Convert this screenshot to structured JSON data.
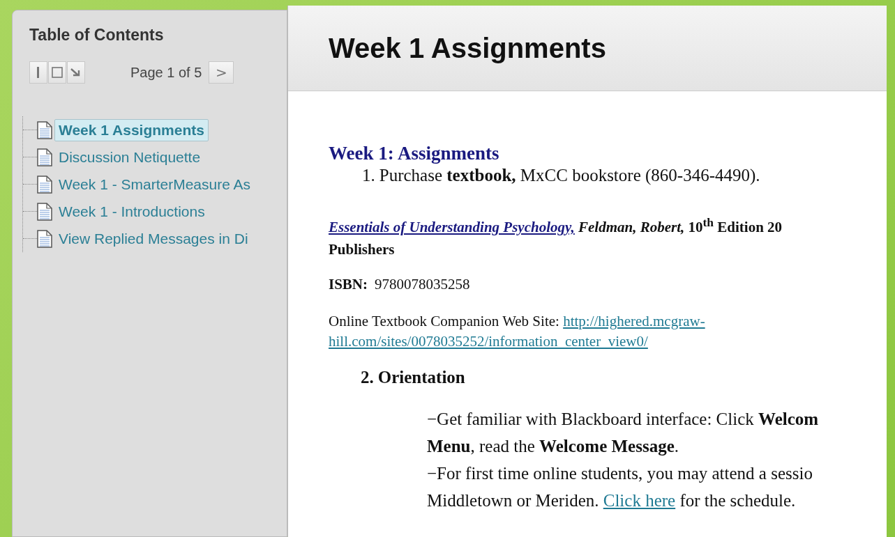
{
  "toc": {
    "title": "Table of Contents",
    "page_label": "Page 1 of 5",
    "next_button": ">",
    "items": [
      {
        "label": "Week 1 Assignments",
        "selected": true
      },
      {
        "label": "Discussion Netiquette",
        "selected": false
      },
      {
        "label": "Week 1 - SmarterMeasure As",
        "selected": false
      },
      {
        "label": "Week 1 - Introductions",
        "selected": false
      },
      {
        "label": "View Replied Messages in Di",
        "selected": false
      }
    ]
  },
  "content": {
    "title": "Week 1 Assignments",
    "blocks": [
      {
        "kind": "heading",
        "text": "Week 1: Assignments"
      },
      {
        "kind": "numbered",
        "number": "1.",
        "text": "Purchase **textbook,** MxCC bookstore (860-346-4490)."
      },
      {
        "kind": "citation",
        "link": "Essentials of Understanding Psychology,",
        "text": "*Feldman, Robert,* 10$^{th}$ Edition 20",
        "second_line": "Publishers"
      },
      {
        "kind": "isbn",
        "label": "ISBN:",
        "value": "9780078035258"
      },
      {
        "kind": "web",
        "label": "Online Textbook Companion Web Site:",
        "link_lines": [
          "http://highered.mcgraw-",
          "hill.com/sites/0078035252/information_center_view0/"
        ]
      },
      {
        "kind": "subheading",
        "number": "2.",
        "text": "Orientation"
      },
      {
        "kind": "lines",
        "lines": [
          {
            "text": "−Get familiar with Blackboard interface: Click **Welcom**"
          },
          {
            "text": "**Menu**, read the **Welcome Message**."
          },
          {
            "text": "−For first time online students, you may attend a sessio"
          },
          {
            "text": "Middletown or Meriden.",
            "link": "Click here",
            "after": "for the schedule."
          }
        ]
      }
    ]
  }
}
